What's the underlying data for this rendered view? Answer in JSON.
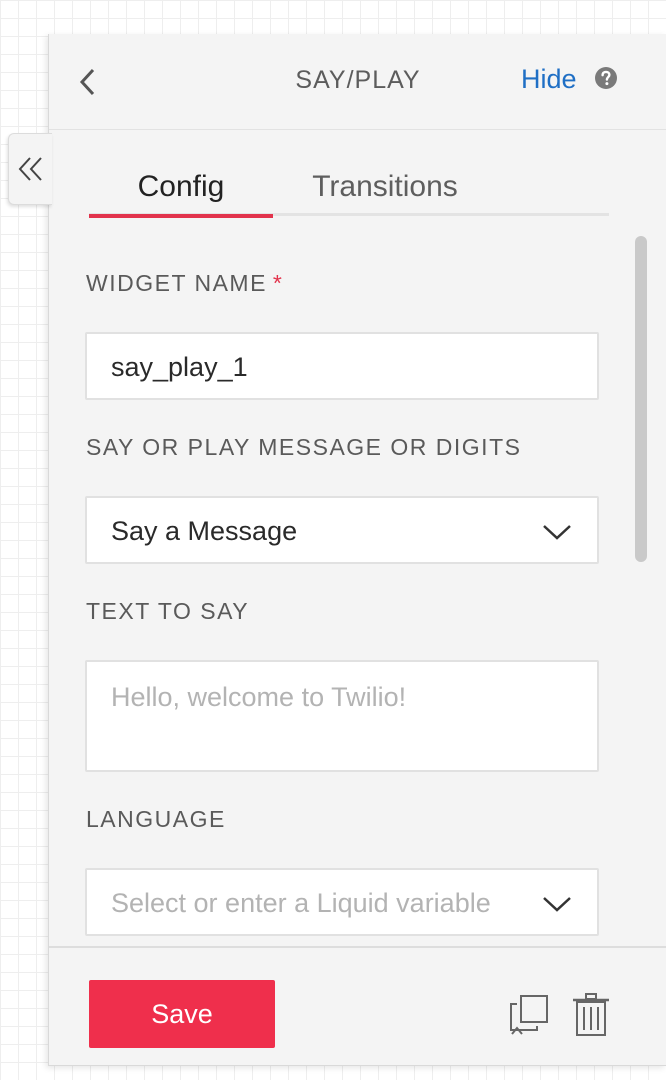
{
  "header": {
    "title": "SAY/PLAY",
    "hide_label": "Hide",
    "back_icon": "chevron-left-icon",
    "help_icon": "question-circle-icon"
  },
  "sidebar_toggle": {
    "icon": "double-chevron-left-icon"
  },
  "tabs": [
    {
      "label": "Config",
      "active": true
    },
    {
      "label": "Transitions",
      "active": false
    }
  ],
  "form": {
    "widget_name": {
      "label": "WIDGET NAME",
      "required_mark": "*",
      "value": "say_play_1"
    },
    "say_or_play": {
      "label": "SAY OR PLAY MESSAGE OR DIGITS",
      "value": "Say a Message"
    },
    "text_to_say": {
      "label": "TEXT TO SAY",
      "value": "",
      "placeholder": "Hello, welcome to Twilio!"
    },
    "language": {
      "label": "LANGUAGE",
      "placeholder": "Select or enter a Liquid variable"
    }
  },
  "footer": {
    "save_label": "Save",
    "duplicate_icon": "duplicate-icon",
    "delete_icon": "trash-icon"
  },
  "colors": {
    "accent": "#ef2f4c",
    "link": "#1f6fc5",
    "panel_bg": "#f4f4f4"
  }
}
